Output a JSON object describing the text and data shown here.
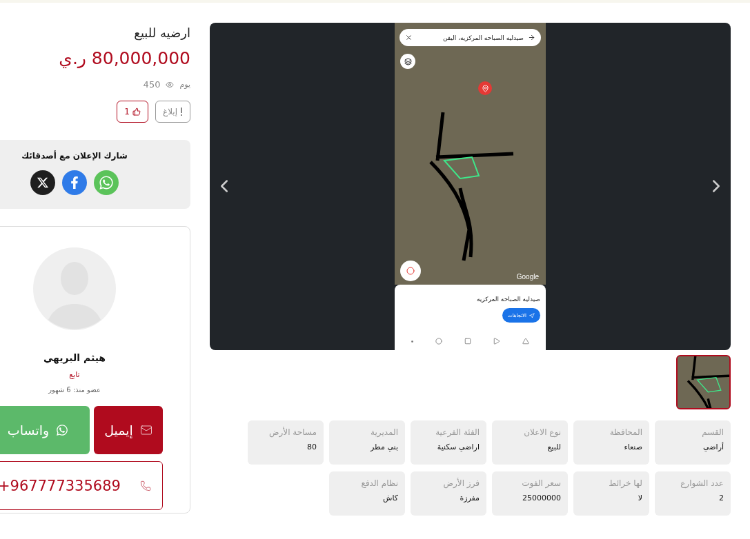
{
  "listing": {
    "title": "ارضيه للبيع",
    "price": "80,000,000 ر.ي",
    "views_unit": "يوم",
    "views_count": "450",
    "report_label": "إبلاغ",
    "like_count": "1"
  },
  "share": {
    "title": "شارك الإعلان مع أصدقائك",
    "networks": [
      {
        "kind": "whatsapp"
      },
      {
        "kind": "facebook"
      },
      {
        "kind": "x"
      }
    ]
  },
  "seller": {
    "name": "هيثم البريهي",
    "status": "تابع",
    "member_since": "عضو منذ: 6 شهور",
    "email_label": "إيميل",
    "whatsapp_label": "واتساب",
    "phone": "+967777335689"
  },
  "gallery": {
    "screenshot": {
      "search_text": "صيدليه الصباحه المركزيه، اليفن",
      "map_credit": "Google",
      "place_name": "صيدليه الصباحه المركزيه",
      "directions_label": "الاتجاهات"
    },
    "thumbnails": [
      {
        "selected": true
      }
    ]
  },
  "details": [
    {
      "label": "القسم",
      "value": "أراضي"
    },
    {
      "label": "المحافظة",
      "value": "صنعاء"
    },
    {
      "label": "نوع الاعلان",
      "value": "للبيع"
    },
    {
      "label": "الفئة الفرعية",
      "value": "اراضي سكنية"
    },
    {
      "label": "المديرية",
      "value": "بني مطر"
    },
    {
      "label": "مساحة الأرض",
      "value": "80"
    },
    {
      "label": "عدد الشوارع",
      "value": "2"
    },
    {
      "label": "لها خرائط",
      "value": "لا"
    },
    {
      "label": "سعر الفوت",
      "value": "25000000"
    },
    {
      "label": "فرز الأرض",
      "value": "مفرزة"
    },
    {
      "label": "نظام الدفع",
      "value": "كاش"
    }
  ]
}
